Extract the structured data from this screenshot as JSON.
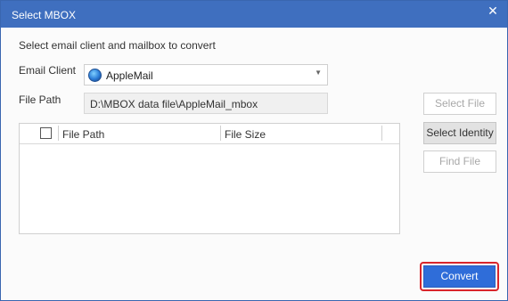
{
  "window": {
    "title": "Select MBOX",
    "close_glyph": "✕"
  },
  "instruction": "Select email client and mailbox to convert",
  "email_client": {
    "label": "Email Client",
    "value": "AppleMail",
    "icon": "applemail-icon"
  },
  "file_path": {
    "label": "File Path",
    "value": "D:\\MBOX data file\\AppleMail_mbox"
  },
  "table": {
    "columns": [
      "File Path",
      "File Size"
    ],
    "rows": []
  },
  "buttons": {
    "select_file": "Select File",
    "select_identity": "Select Identity",
    "find_file": "Find File",
    "convert": "Convert"
  },
  "colors": {
    "titlebar": "#3f6fbf",
    "convert": "#2f6dd9",
    "highlight": "#d9252b"
  }
}
